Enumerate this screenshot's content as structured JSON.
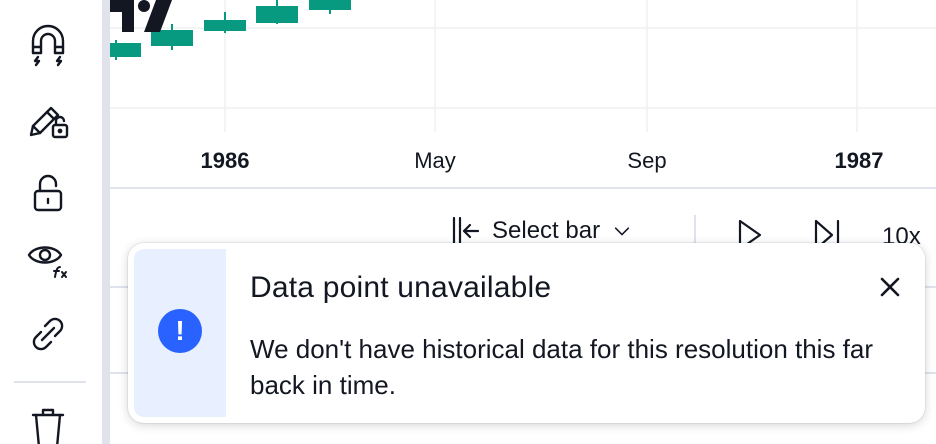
{
  "toolbar": {
    "icons": [
      "magnet-icon",
      "lock-drawings-icon",
      "unlock-icon",
      "eye-fx-icon",
      "link-icon",
      "trash-icon"
    ]
  },
  "chart": {
    "logo": "TradingView",
    "candle_color": "#089981",
    "time_axis": {
      "labels": [
        {
          "text": "1986",
          "major": true
        },
        {
          "text": "May",
          "major": false
        },
        {
          "text": "Sep",
          "major": false
        },
        {
          "text": "1987",
          "major": true
        }
      ]
    }
  },
  "replay_bar": {
    "select_bar_label": "Select bar",
    "speed_label": "10x"
  },
  "toast": {
    "icon": "!",
    "title": "Data point unavailable",
    "message": "We don't have historical data for this resolution this far back in time.",
    "accent_color": "#2962ff"
  }
}
